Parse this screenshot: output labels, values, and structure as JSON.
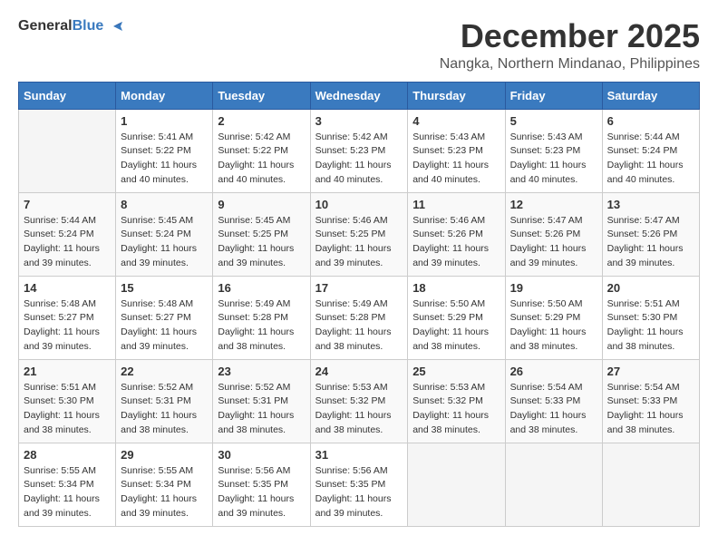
{
  "logo": {
    "general": "General",
    "blue": "Blue"
  },
  "title": "December 2025",
  "location": "Nangka, Northern Mindanao, Philippines",
  "days_header": [
    "Sunday",
    "Monday",
    "Tuesday",
    "Wednesday",
    "Thursday",
    "Friday",
    "Saturday"
  ],
  "weeks": [
    [
      {
        "day": "",
        "info": ""
      },
      {
        "day": "1",
        "info": "Sunrise: 5:41 AM\nSunset: 5:22 PM\nDaylight: 11 hours and 40 minutes."
      },
      {
        "day": "2",
        "info": "Sunrise: 5:42 AM\nSunset: 5:22 PM\nDaylight: 11 hours and 40 minutes."
      },
      {
        "day": "3",
        "info": "Sunrise: 5:42 AM\nSunset: 5:23 PM\nDaylight: 11 hours and 40 minutes."
      },
      {
        "day": "4",
        "info": "Sunrise: 5:43 AM\nSunset: 5:23 PM\nDaylight: 11 hours and 40 minutes."
      },
      {
        "day": "5",
        "info": "Sunrise: 5:43 AM\nSunset: 5:23 PM\nDaylight: 11 hours and 40 minutes."
      },
      {
        "day": "6",
        "info": "Sunrise: 5:44 AM\nSunset: 5:24 PM\nDaylight: 11 hours and 40 minutes."
      }
    ],
    [
      {
        "day": "7",
        "info": "Sunrise: 5:44 AM\nSunset: 5:24 PM\nDaylight: 11 hours and 39 minutes."
      },
      {
        "day": "8",
        "info": "Sunrise: 5:45 AM\nSunset: 5:24 PM\nDaylight: 11 hours and 39 minutes."
      },
      {
        "day": "9",
        "info": "Sunrise: 5:45 AM\nSunset: 5:25 PM\nDaylight: 11 hours and 39 minutes."
      },
      {
        "day": "10",
        "info": "Sunrise: 5:46 AM\nSunset: 5:25 PM\nDaylight: 11 hours and 39 minutes."
      },
      {
        "day": "11",
        "info": "Sunrise: 5:46 AM\nSunset: 5:26 PM\nDaylight: 11 hours and 39 minutes."
      },
      {
        "day": "12",
        "info": "Sunrise: 5:47 AM\nSunset: 5:26 PM\nDaylight: 11 hours and 39 minutes."
      },
      {
        "day": "13",
        "info": "Sunrise: 5:47 AM\nSunset: 5:26 PM\nDaylight: 11 hours and 39 minutes."
      }
    ],
    [
      {
        "day": "14",
        "info": "Sunrise: 5:48 AM\nSunset: 5:27 PM\nDaylight: 11 hours and 39 minutes."
      },
      {
        "day": "15",
        "info": "Sunrise: 5:48 AM\nSunset: 5:27 PM\nDaylight: 11 hours and 39 minutes."
      },
      {
        "day": "16",
        "info": "Sunrise: 5:49 AM\nSunset: 5:28 PM\nDaylight: 11 hours and 38 minutes."
      },
      {
        "day": "17",
        "info": "Sunrise: 5:49 AM\nSunset: 5:28 PM\nDaylight: 11 hours and 38 minutes."
      },
      {
        "day": "18",
        "info": "Sunrise: 5:50 AM\nSunset: 5:29 PM\nDaylight: 11 hours and 38 minutes."
      },
      {
        "day": "19",
        "info": "Sunrise: 5:50 AM\nSunset: 5:29 PM\nDaylight: 11 hours and 38 minutes."
      },
      {
        "day": "20",
        "info": "Sunrise: 5:51 AM\nSunset: 5:30 PM\nDaylight: 11 hours and 38 minutes."
      }
    ],
    [
      {
        "day": "21",
        "info": "Sunrise: 5:51 AM\nSunset: 5:30 PM\nDaylight: 11 hours and 38 minutes."
      },
      {
        "day": "22",
        "info": "Sunrise: 5:52 AM\nSunset: 5:31 PM\nDaylight: 11 hours and 38 minutes."
      },
      {
        "day": "23",
        "info": "Sunrise: 5:52 AM\nSunset: 5:31 PM\nDaylight: 11 hours and 38 minutes."
      },
      {
        "day": "24",
        "info": "Sunrise: 5:53 AM\nSunset: 5:32 PM\nDaylight: 11 hours and 38 minutes."
      },
      {
        "day": "25",
        "info": "Sunrise: 5:53 AM\nSunset: 5:32 PM\nDaylight: 11 hours and 38 minutes."
      },
      {
        "day": "26",
        "info": "Sunrise: 5:54 AM\nSunset: 5:33 PM\nDaylight: 11 hours and 38 minutes."
      },
      {
        "day": "27",
        "info": "Sunrise: 5:54 AM\nSunset: 5:33 PM\nDaylight: 11 hours and 38 minutes."
      }
    ],
    [
      {
        "day": "28",
        "info": "Sunrise: 5:55 AM\nSunset: 5:34 PM\nDaylight: 11 hours and 39 minutes."
      },
      {
        "day": "29",
        "info": "Sunrise: 5:55 AM\nSunset: 5:34 PM\nDaylight: 11 hours and 39 minutes."
      },
      {
        "day": "30",
        "info": "Sunrise: 5:56 AM\nSunset: 5:35 PM\nDaylight: 11 hours and 39 minutes."
      },
      {
        "day": "31",
        "info": "Sunrise: 5:56 AM\nSunset: 5:35 PM\nDaylight: 11 hours and 39 minutes."
      },
      {
        "day": "",
        "info": ""
      },
      {
        "day": "",
        "info": ""
      },
      {
        "day": "",
        "info": ""
      }
    ]
  ]
}
